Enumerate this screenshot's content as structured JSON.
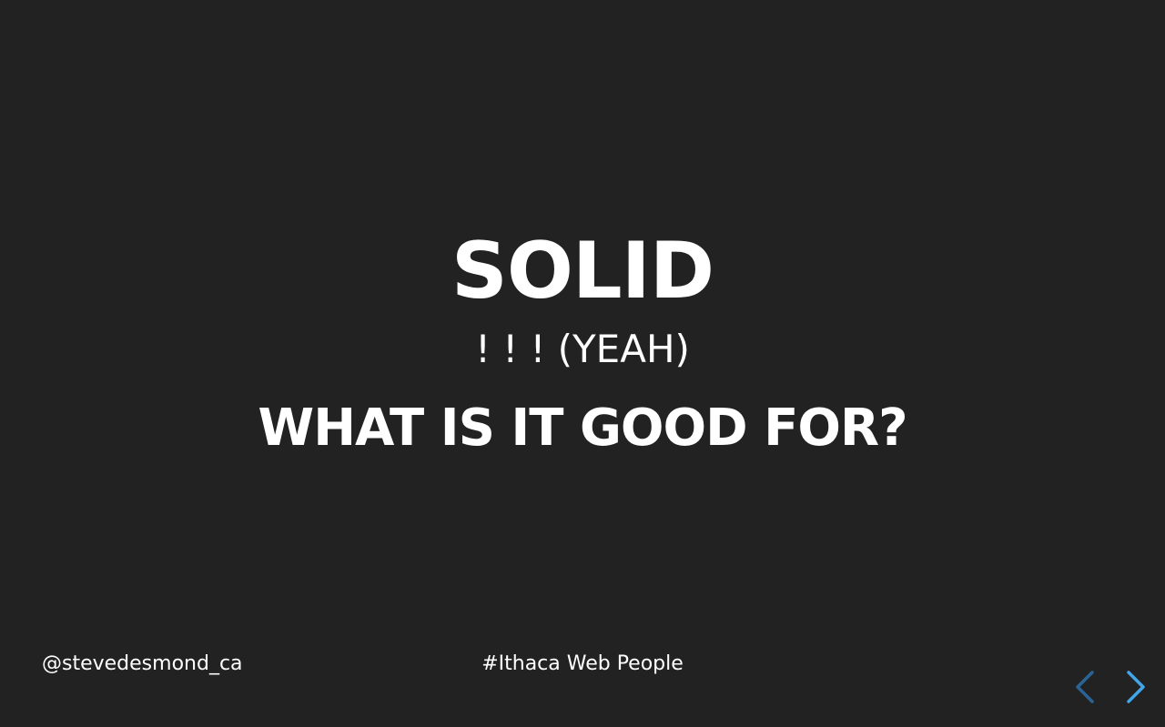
{
  "slide": {
    "title": "SOLID",
    "subtitle": "! ! ! (YEAH)",
    "question": "WHAT IS IT GOOD FOR?"
  },
  "footer": {
    "handle": "@stevedesmond_ca",
    "hashtag": "#Ithaca Web People"
  },
  "navigation": {
    "prev_icon": "chevron-left-icon",
    "next_icon": "chevron-right-icon",
    "prev_color": "#2a6496",
    "next_color": "#42a5e8"
  },
  "colors": {
    "background": "#222222",
    "text": "#ffffff"
  }
}
